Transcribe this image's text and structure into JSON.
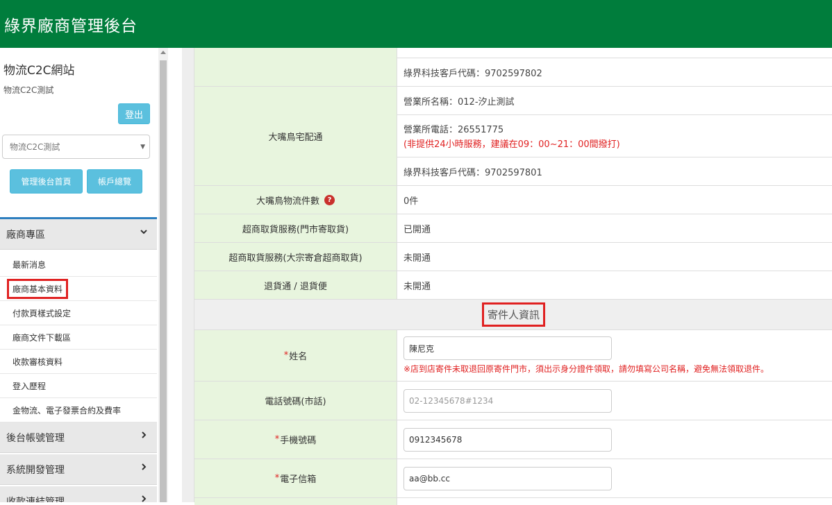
{
  "header": {
    "title": "綠界廠商管理後台"
  },
  "sidebar": {
    "site_name": "物流C2C網站",
    "site_sub": "物流C2C測試",
    "logout_label": "登出",
    "site_select_value": "物流C2C測試",
    "home_button": "管理後台首頁",
    "overview_button": "帳戶總覽",
    "menu": {
      "vendor_zone": "廠商專區",
      "items": [
        "最新消息",
        "廠商基本資料",
        "付款頁樣式設定",
        "廠商文件下載區",
        "收款審核資料",
        "登入歷程",
        "金物流、電子發票合約及費率"
      ],
      "account_mgmt": "後台帳號管理",
      "sys_dev": "系統開發管理",
      "payment_link": "收款連結管理"
    }
  },
  "table": {
    "r0_code": "綠界科技客戶代碼：9702597802",
    "tcat_label": "大嘴鳥宅配通",
    "tcat_office_name": "營業所名稱：012-汐止測試",
    "tcat_office_phone": "營業所電話：26551775",
    "tcat_office_note": "(非提供24小時服務，建議在09：00~21：00間撥打)",
    "tcat_code": "綠界科技客戶代碼：9702597801",
    "count_label": "大嘴鳥物流件數",
    "count_help": "?",
    "count_value": "0件",
    "cvs_store_label": "超商取貨服務(門市寄取貨)",
    "cvs_store_value": "已開通",
    "cvs_bulk_label": "超商取貨服務(大宗寄倉超商取貨)",
    "cvs_bulk_value": "未開通",
    "return_label": "退貨通 / 退貨便",
    "return_value": "未開通",
    "sender_section": "寄件人資訊",
    "req_mark": "*",
    "name_label": "姓名",
    "name_value": "陳尼克",
    "name_note": "※店到店寄件未取退回原寄件門市，須出示身分證件領取，請勿填寫公司名稱，避免無法領取退件。",
    "tel_label": "電話號碼(市話)",
    "tel_placeholder": "02-12345678#1234",
    "mobile_label": "手機號碼",
    "mobile_value": "0912345678",
    "email_label": "電子信箱",
    "email_value": "aa@bb.cc"
  },
  "colors": {
    "header_green": "#007d3c",
    "label_bg": "#e8f5de",
    "info_button": "#5bc0de",
    "highlight_red": "#e02020"
  }
}
